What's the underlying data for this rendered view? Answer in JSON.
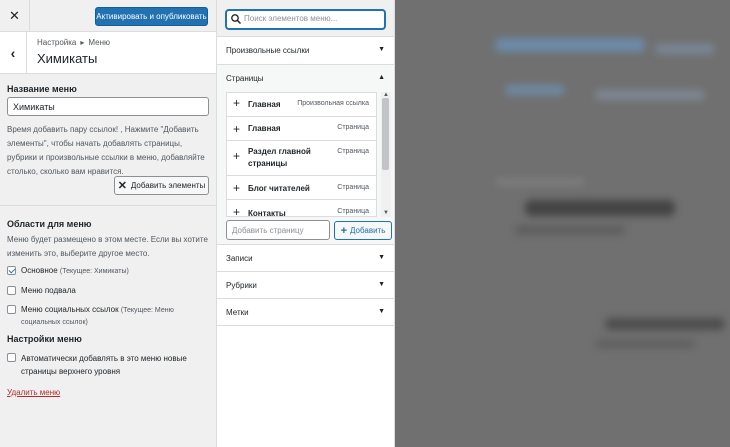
{
  "topbar": {
    "close_icon": "close-icon",
    "publish_label": "Активировать и опубликовать"
  },
  "section": {
    "breadcrumb_root": "Настройка",
    "breadcrumb_sep": "▸",
    "breadcrumb_leaf": "Меню",
    "title": "Химикаты",
    "back_icon": "chevron-left-icon"
  },
  "menu_name": {
    "label": "Название меню",
    "value": "Химикаты",
    "help": "Время добавить пару ссылок! , Нажмите \"Добавить элементы\", чтобы начать добавлять страницы, рубрики и произвольные ссылки в меню, добавляйте столько, сколько вам нравится.",
    "add_items_label": "Добавить элементы"
  },
  "locations": {
    "label": "Области для меню",
    "help": "Меню будет размещено в этом месте. Если вы хотите изменить это, выберите другое место.",
    "items": [
      {
        "label": "Основное",
        "note": "(Текущее: Химикаты)",
        "checked": true
      },
      {
        "label": "Меню подвала",
        "note": "",
        "checked": false
      },
      {
        "label": "Меню социальных ссылок",
        "note": "(Текущее: Меню социальных ссылок)",
        "checked": false
      }
    ]
  },
  "settings": {
    "label": "Настройки меню",
    "auto_add": "Автоматически добавлять в это меню новые страницы верхнего уровня"
  },
  "delete_label": "Удалить меню",
  "search": {
    "placeholder": "Поиск элементов меню..."
  },
  "panels": {
    "custom_links": "Произвольные ссылки",
    "pages": "Страницы",
    "posts": "Записи",
    "categories": "Рубрики",
    "tags": "Метки"
  },
  "pages": [
    {
      "name": "Главная",
      "type": "Произвольная ссылка"
    },
    {
      "name": "Главная",
      "type": "Страница"
    },
    {
      "name": "Раздел главной страницы",
      "type": "Страница"
    },
    {
      "name": "Блог читателей",
      "type": "Страница"
    },
    {
      "name": "Контакты",
      "type": "Страница"
    }
  ],
  "add_page": {
    "placeholder": "Добавить страницу",
    "button": "Добавить"
  },
  "colors": {
    "accent": "#2271b1",
    "danger": "#b32d2e",
    "panel_bg": "#f0f0f1"
  }
}
